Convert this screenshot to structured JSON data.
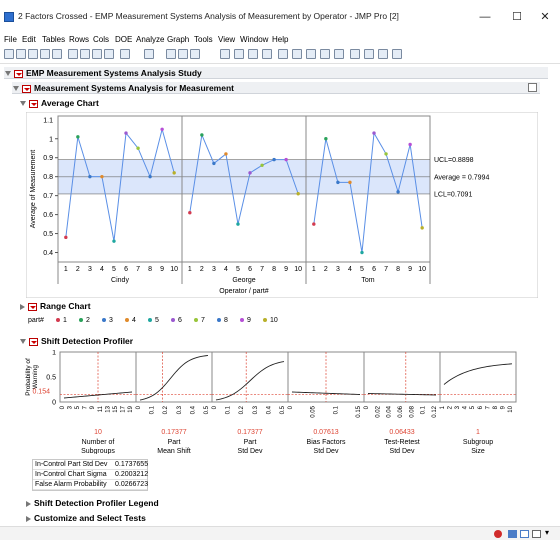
{
  "window": {
    "title": "2 Factors Crossed - EMP Measurement Systems Analysis of Measurement by Operator - JMP Pro [2]",
    "controls": [
      "—",
      "☐",
      "✕"
    ]
  },
  "menu": [
    "File",
    "Edit",
    "Tables",
    "Rows",
    "Cols",
    "DOE",
    "Analyze",
    "Graph",
    "Tools",
    "View",
    "Window",
    "Help"
  ],
  "report": {
    "study_title": "EMP Measurement Systems Analysis Study",
    "analysis_title": "Measurement Systems Analysis for Measurement",
    "average_chart_title": "Average Chart",
    "range_chart_title": "Range Chart",
    "profiler_title": "Shift Detection Profiler",
    "legend_title": "Shift Detection Profiler Legend",
    "customize_title": "Customize and Select Tests",
    "part_label": "part#"
  },
  "chart_data": [
    {
      "type": "line",
      "title": "Average Chart",
      "ylabel": "Average of Measurement",
      "xlabel": "Operator / part#",
      "ylim": [
        0.35,
        1.12
      ],
      "yticks": [
        0.4,
        0.5,
        0.6,
        0.7,
        0.8,
        0.9,
        1
      ],
      "ytick_labels": [
        "0.4",
        "0.5",
        "0.6",
        "0.7",
        "0.8",
        "0.9",
        "1"
      ],
      "ytick_top_label": "1.1",
      "groups": [
        "Cindy",
        "George",
        "Tom"
      ],
      "categories": [
        "1",
        "2",
        "3",
        "4",
        "5",
        "6",
        "7",
        "8",
        "9",
        "10"
      ],
      "series": [
        {
          "values": [
            0.48,
            1.01,
            0.8,
            0.8,
            0.46,
            1.03,
            0.95,
            0.8,
            1.05,
            0.82
          ]
        },
        {
          "values": [
            0.61,
            1.02,
            0.87,
            0.92,
            0.55,
            0.82,
            0.86,
            0.89,
            0.89,
            0.71
          ]
        },
        {
          "values": [
            0.55,
            1.0,
            0.77,
            0.77,
            0.4,
            1.03,
            0.92,
            0.72,
            0.97,
            0.53
          ]
        }
      ],
      "limits": {
        "UCL": 0.8898,
        "Average": 0.7994,
        "LCL": 0.7091
      },
      "limit_labels": {
        "UCL": "UCL=0.8898",
        "Average": "Average = 0.7994",
        "LCL": "LCL=0.7091"
      },
      "point_colors": [
        "#d33a4f",
        "#2aa25a",
        "#3a78c9",
        "#e08a2b",
        "#1fa7a0",
        "#9b59d0",
        "#98c53a",
        "#3a78c9",
        "#b64fd6",
        "#b8b02a"
      ],
      "line_color": "#5a8fe6",
      "band_color": "#dbe6fb"
    }
  ],
  "range_legend": [
    {
      "label": "1",
      "color": "#d33a4f"
    },
    {
      "label": "2",
      "color": "#2aa25a"
    },
    {
      "label": "3",
      "color": "#3a78c9"
    },
    {
      "label": "4",
      "color": "#e08a2b"
    },
    {
      "label": "5",
      "color": "#1fa7a0"
    },
    {
      "label": "6",
      "color": "#9b59d0"
    },
    {
      "label": "7",
      "color": "#98c53a"
    },
    {
      "label": "8",
      "color": "#3a78c9"
    },
    {
      "label": "9",
      "color": "#b64fd6"
    },
    {
      "label": "10",
      "color": "#b8b02a"
    }
  ],
  "profiler": {
    "ylabel_line1": "Probability of",
    "ylabel_line2": "Warning",
    "current_value": "0.154",
    "yticks": [
      "1",
      "0.5",
      "0"
    ],
    "panels": [
      {
        "value": "10",
        "label1": "Number of",
        "label2": "Subgroups",
        "ticks": [
          "0",
          "3",
          "5",
          "7",
          "9",
          "11",
          "13",
          "15",
          "17",
          "19"
        ]
      },
      {
        "value": "0.17377",
        "label1": "Part",
        "label2": "Mean Shift",
        "ticks": [
          "0",
          "0.1",
          "0.2",
          "0.3",
          "0.4",
          "0.5"
        ]
      },
      {
        "value": "0.17377",
        "label1": "Part",
        "label2": "Std Dev",
        "ticks": [
          "0",
          "0.1",
          "0.2",
          "0.3",
          "0.4",
          "0.5"
        ]
      },
      {
        "value": "0.07613",
        "label1": "Bias Factors",
        "label2": "Std Dev",
        "ticks": [
          "0",
          "0.05",
          "0.1",
          "0.15"
        ]
      },
      {
        "value": "0.06433",
        "label1": "Test-Retest",
        "label2": "Std Dev",
        "ticks": [
          "0",
          "0.02",
          "0.04",
          "0.06",
          "0.08",
          "0.1",
          "0.12"
        ]
      },
      {
        "value": "1",
        "label1": "Subgroup",
        "label2": "Size",
        "ticks": [
          "1",
          "2",
          "3",
          "4",
          "5",
          "6",
          "7",
          "8",
          "9",
          "10"
        ]
      }
    ]
  },
  "stats": [
    {
      "label": "In-Control Part Std Dev",
      "value": "0.1737655"
    },
    {
      "label": "In-Control Chart Sigma",
      "value": "0.2003212"
    },
    {
      "label": "False Alarm Probability",
      "value": "0.0266723"
    }
  ]
}
